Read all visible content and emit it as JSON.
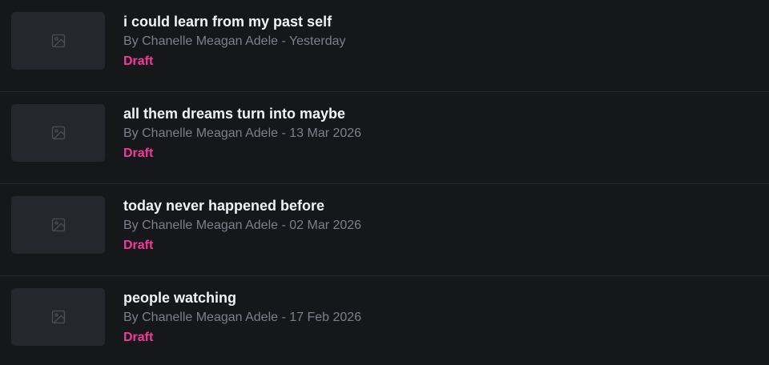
{
  "posts": [
    {
      "title": "i could learn from my past self",
      "meta": "By Chanelle Meagan Adele - Yesterday",
      "status": "Draft",
      "thumbnail_icon": "image-placeholder-icon"
    },
    {
      "title": "all them dreams turn into maybe",
      "meta": "By Chanelle Meagan Adele - 13 Mar 2026",
      "status": "Draft",
      "thumbnail_icon": "image-placeholder-icon"
    },
    {
      "title": "today never happened before",
      "meta": "By Chanelle Meagan Adele - 02 Mar 2026",
      "status": "Draft",
      "thumbnail_icon": "image-placeholder-icon"
    },
    {
      "title": "people watching",
      "meta": "By Chanelle Meagan Adele - 17 Feb 2026",
      "status": "Draft",
      "thumbnail_icon": "image-placeholder-icon"
    }
  ],
  "colors": {
    "background": "#15171b",
    "thumbnail": "#24272d",
    "title": "#f2f3f5",
    "meta": "#7b808a",
    "status_draft": "#f5389a",
    "divider": "#262930"
  }
}
